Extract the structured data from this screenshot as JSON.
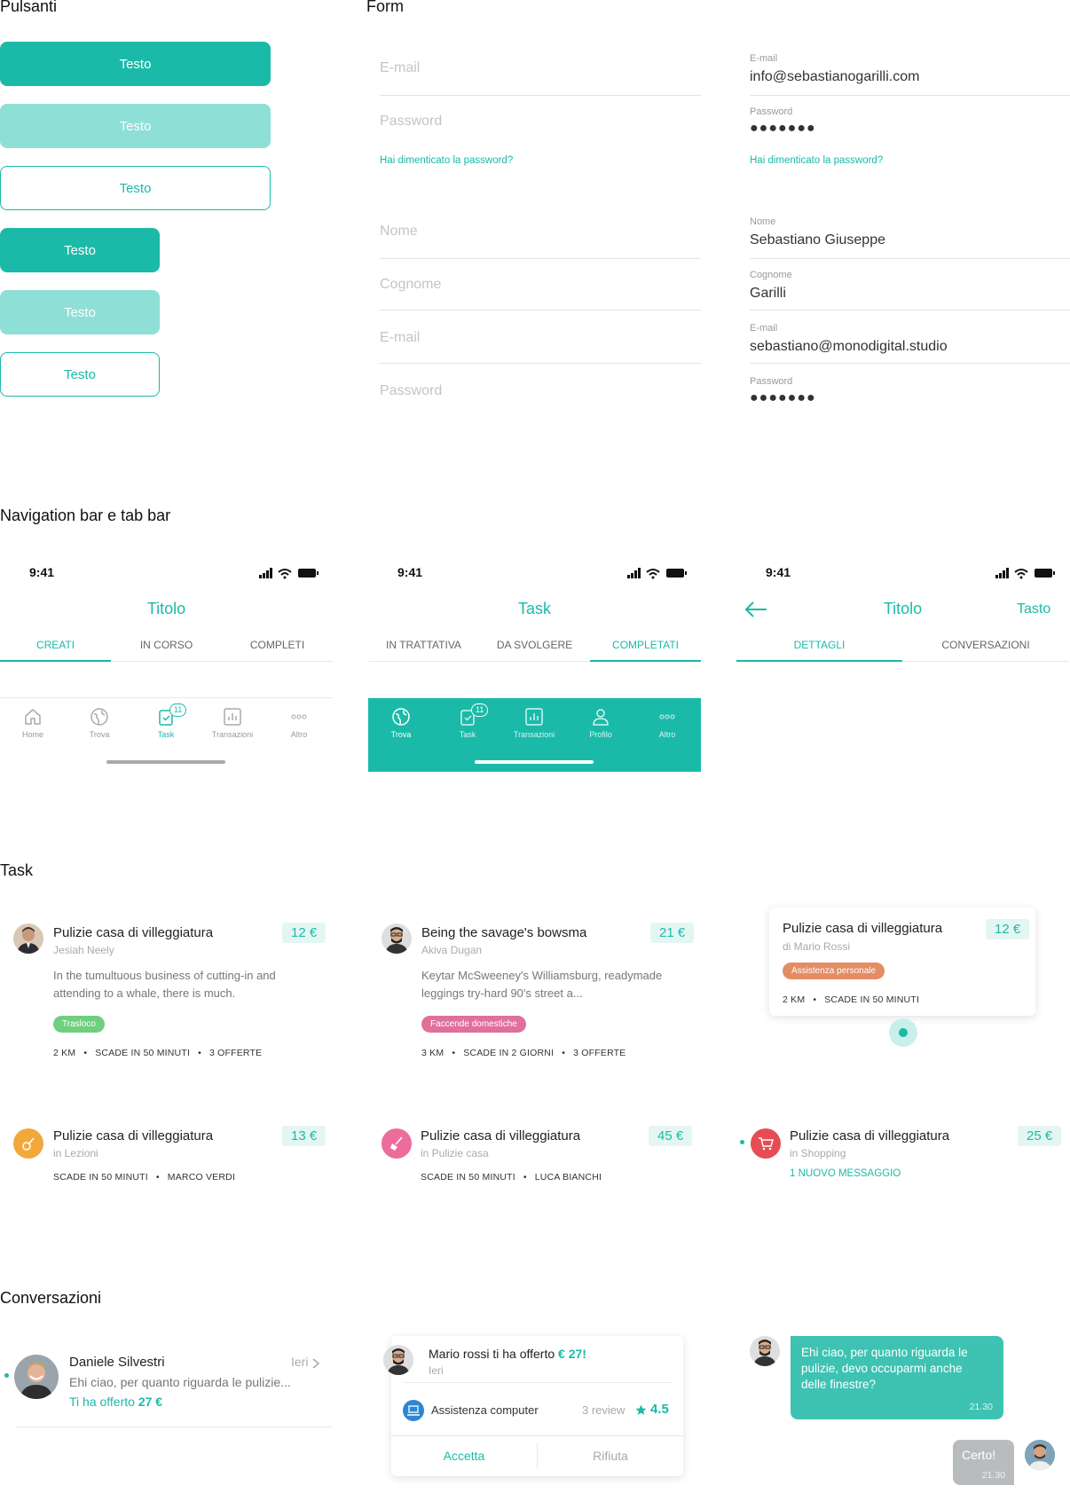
{
  "sections": {
    "pulsanti": "Pulsanti",
    "form": "Form",
    "navigation": "Navigation bar e tab bar",
    "task": "Task",
    "conversazioni": "Conversazioni"
  },
  "buttons": {
    "label": "Testo"
  },
  "form_empty": {
    "email_placeholder": "E-mail",
    "password_placeholder": "Password",
    "forgot": "Hai dimenticato la password?",
    "nome_placeholder": "Nome",
    "cognome_placeholder": "Cognome",
    "email2_placeholder": "E-mail",
    "password2_placeholder": "Password"
  },
  "form_filled": {
    "email_label": "E-mail",
    "email_value": "info@sebastianogarilli.com",
    "password_label": "Password",
    "password_value": "●●●●●●●",
    "forgot": "Hai dimenticato la password?",
    "nome_label": "Nome",
    "nome_value": "Sebastiano Giuseppe",
    "cognome_label": "Cognome",
    "cognome_value": "Garilli",
    "email2_label": "E-mail",
    "email2_value": "sebastiano@monodigital.studio",
    "password2_label": "Password",
    "password2_value": "●●●●●●●"
  },
  "screens": [
    {
      "time": "9:41",
      "title": "Titolo",
      "tabs": [
        "CREATI",
        "IN CORSO",
        "COMPLETI"
      ],
      "tabbar": [
        "Home",
        "Trova",
        "Task",
        "Transazioni",
        "Altro"
      ],
      "badge": "11"
    },
    {
      "time": "9:41",
      "title": "Task",
      "tabs": [
        "IN TRATTATIVA",
        "DA SVOLGERE",
        "COMPLETATI"
      ],
      "tabbar": [
        "Trova",
        "Task",
        "Transazioni",
        "Profilo",
        "Altro"
      ],
      "badge": "11"
    },
    {
      "time": "9:41",
      "title": "Titolo",
      "action": "Tasto",
      "tabs": [
        "DETTAGLI",
        "CONVERSAZIONI"
      ]
    }
  ],
  "tasks": [
    {
      "title": "Pulizie casa di villeggiatura",
      "sub": "Jesiah Neely",
      "price": "12 €",
      "desc": "In the tumultuous business of cutting-in and attending to a whale, there is much.",
      "tag": "Trasloco",
      "meta": [
        "2 KM",
        "SCADE IN 50 MINUTI",
        "3 OFFERTE"
      ]
    },
    {
      "title": "Being the savage's bowsma",
      "sub": "Akiva Dugan",
      "price": "21 €",
      "desc": "Keytar McSweeney's Williamsburg, readymade leggings try-hard 90's street a...",
      "tag": "Faccende domestiche",
      "meta": [
        "3 KM",
        "SCADE IN 2 GIORNI",
        "3 OFFERTE"
      ]
    },
    {
      "title": "Pulizie casa di villeggiatura",
      "sub": "di Mario Rossi",
      "price": "12 €",
      "tag": "Assistenza personale",
      "meta": [
        "2 KM",
        "SCADE IN 50 MINUTI"
      ]
    },
    {
      "title": "Pulizie casa di villeggiatura",
      "sub": "in Lezioni",
      "price": "13 €",
      "meta": [
        "SCADE IN 50 MINUTI",
        "MARCO VERDI"
      ]
    },
    {
      "title": "Pulizie casa di villeggiatura",
      "sub": "in Pulizie casa",
      "price": "45 €",
      "meta": [
        "SCADE IN 50 MINUTI",
        "LUCA BIANCHI"
      ]
    },
    {
      "title": "Pulizie casa di villeggiatura",
      "sub": "in Shopping",
      "price": "25 €",
      "message": "1 NUOVO MESSAGGIO"
    }
  ],
  "colors": {
    "accent": "#1bbaa8",
    "accent_light": "#8edfd6",
    "tag_green": "#6fcf7f",
    "tag_pink": "#e0709b",
    "tag_orange": "#e38d65",
    "cat_orange": "#f2a93b",
    "cat_pink": "#ec6c9b",
    "cat_red": "#e74c54"
  },
  "conversation": {
    "name": "Daniele Silvestri",
    "time": "Ieri",
    "preview": "Ehi ciao, per quanto riguarda le pulizie...",
    "offer_prefix": "Ti ha offerto",
    "offer_amount": "27 €"
  },
  "offer_card": {
    "text": "Mario rossi ti ha offerto",
    "amount": "€ 27!",
    "time": "Ieri",
    "service": "Assistenza computer",
    "reviews": "3 review",
    "rating": "4.5",
    "accept": "Accetta",
    "reject": "Rifiuta"
  },
  "chat": {
    "incoming": "Ehi ciao, per quanto riguarda le pulizie, devo occuparmi anche delle finestre?",
    "incoming_time": "21.30",
    "outgoing": "Certo!",
    "outgoing_time": "21.30"
  }
}
